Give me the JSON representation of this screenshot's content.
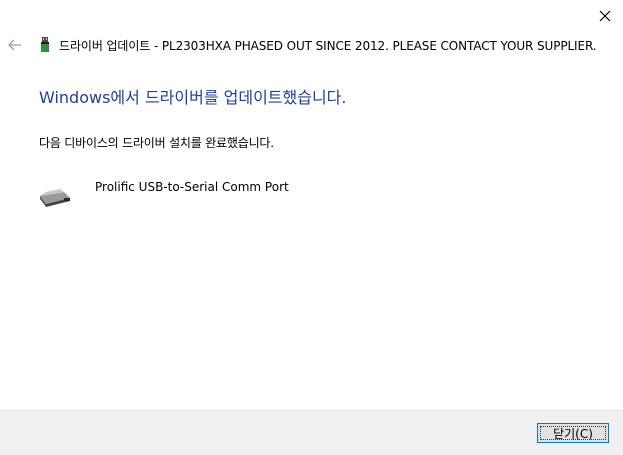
{
  "window": {
    "close_icon": "close-icon"
  },
  "header": {
    "back_icon": "back-arrow-icon",
    "device_icon": "usb-device-icon",
    "title": "드라이버 업데이트 - PL2303HXA PHASED OUT SINCE 2012. PLEASE CONTACT YOUR SUPPLIER."
  },
  "main": {
    "heading": "Windows에서 드라이버를 업데이트했습니다.",
    "description": "다음 디바이스의 드라이버 설치를 완료했습니다.",
    "device": {
      "icon": "serial-port-icon",
      "name": "Prolific USB-to-Serial Comm Port"
    }
  },
  "footer": {
    "close_button_label": "닫기(C)"
  },
  "colors": {
    "heading": "#1f3f9e",
    "focus_border": "#0078d7",
    "footer_bg": "#f0f0f0"
  }
}
